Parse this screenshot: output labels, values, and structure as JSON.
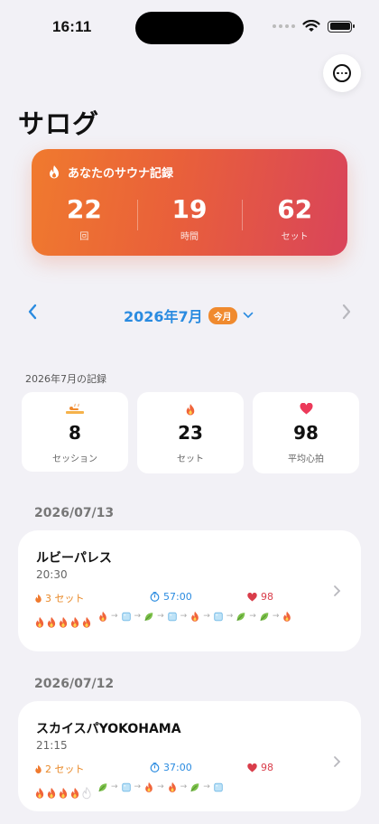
{
  "status_bar": {
    "time": "16:11"
  },
  "header": {
    "title": "サログ"
  },
  "hero": {
    "title": "あなたのサウナ記録",
    "stats": [
      {
        "value": "22",
        "unit": "回"
      },
      {
        "value": "19",
        "unit": "時間"
      },
      {
        "value": "62",
        "unit": "セット"
      }
    ]
  },
  "month_nav": {
    "label": "2026年7月",
    "badge": "今月"
  },
  "summary": {
    "section_label": "2026年7月の記録",
    "cards": [
      {
        "icon": "sauna-icon",
        "value": "8",
        "label": "セッション"
      },
      {
        "icon": "flame-icon",
        "value": "23",
        "label": "セット"
      },
      {
        "icon": "heart-icon",
        "value": "98",
        "label": "平均心拍"
      }
    ]
  },
  "records": [
    {
      "date": "2026/07/13",
      "name": "ルビーパレス",
      "time": "20:30",
      "sets": "3 セット",
      "duration": "57:00",
      "heart_rate": "98",
      "rating": 5,
      "flow": [
        "sauna",
        "water",
        "rest",
        "water",
        "sauna",
        "water",
        "rest",
        "rest",
        "sauna"
      ]
    },
    {
      "date": "2026/07/12",
      "name": "スカイスパYOKOHAMA",
      "time": "21:15",
      "sets": "2 セット",
      "duration": "37:00",
      "heart_rate": "98",
      "rating": 4,
      "flow": [
        "rest",
        "water",
        "sauna",
        "sauna",
        "rest",
        "water"
      ]
    }
  ],
  "colors": {
    "accent_blue": "#2a8be0",
    "accent_orange": "#f07a2e",
    "heart_red": "#d93d4a"
  }
}
